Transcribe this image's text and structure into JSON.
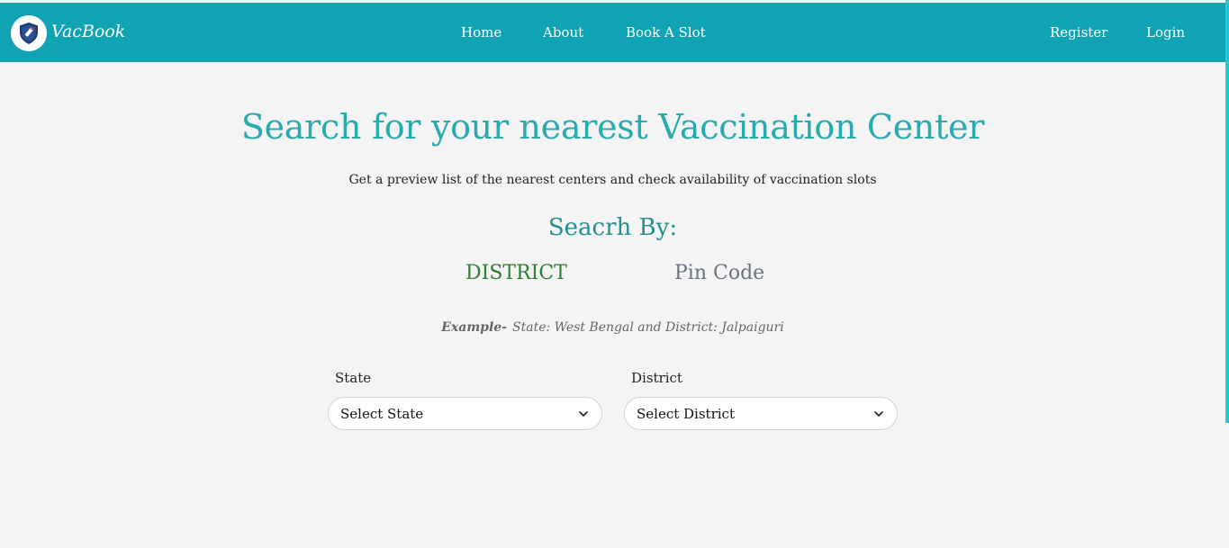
{
  "navbar": {
    "brand": "VacBook",
    "logo_icon": "shield-syringe-icon",
    "links": {
      "home": "Home",
      "about": "About",
      "book": "Book A Slot",
      "register": "Register",
      "login": "Login"
    },
    "color": "#10a3b3"
  },
  "main": {
    "title": "Search for your nearest Vaccination Center",
    "subtitle": "Get a preview list of the nearest centers and check availability of vaccination slots",
    "search_by": "Seacrh By:",
    "tabs": {
      "district": "DISTRICT",
      "pin": "Pin Code"
    },
    "example": {
      "prefix": "Example-",
      "text": "State: West Bengal and District: Jalpaiguri"
    },
    "state_field": {
      "label": "State",
      "selected": "Select State"
    },
    "district_field": {
      "label": "District",
      "selected": "Select District"
    }
  },
  "colors": {
    "accent": "#27aab0",
    "active_tab": "#2e7d32",
    "inactive_tab": "#6b7280",
    "background": "#f4f4f4"
  }
}
